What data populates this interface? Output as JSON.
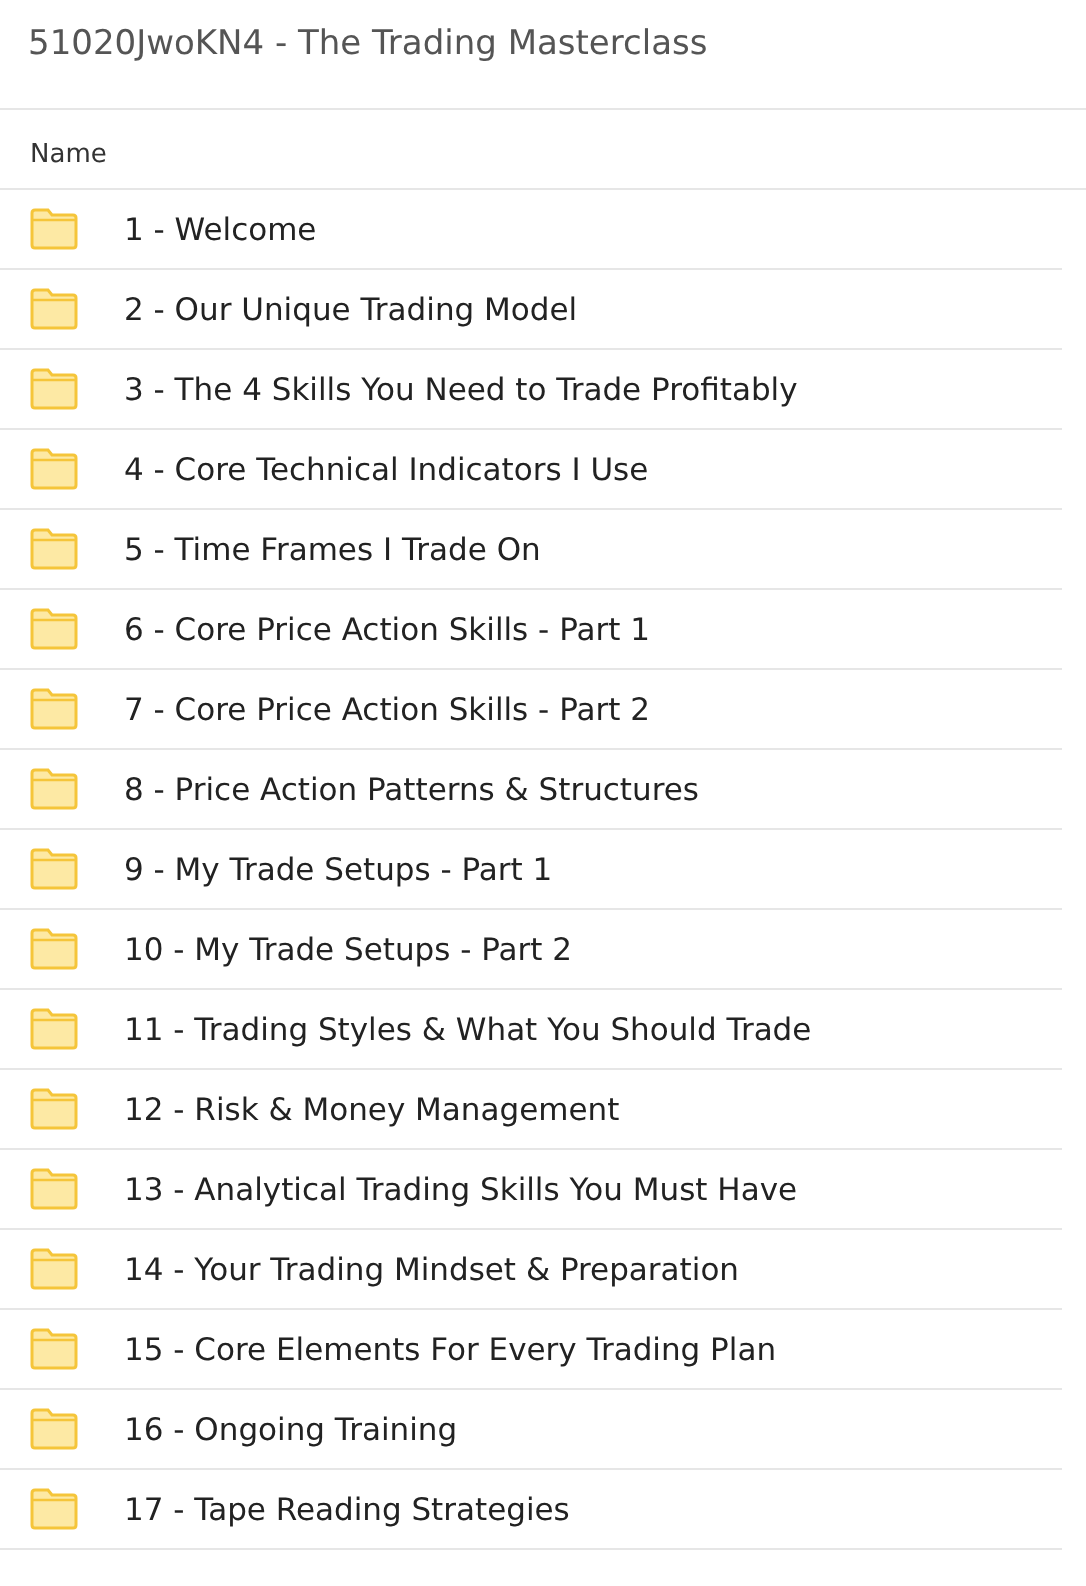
{
  "title": "51020JwoKN4 - The Trading Masterclass",
  "column_header": "Name",
  "items": [
    {
      "name": "1 - Welcome"
    },
    {
      "name": "2 - Our Unique Trading Model"
    },
    {
      "name": "3 - The 4 Skills You Need to Trade Profitably"
    },
    {
      "name": "4 - Core Technical Indicators I Use"
    },
    {
      "name": "5 - Time Frames I Trade On"
    },
    {
      "name": "6 - Core Price Action Skills - Part 1"
    },
    {
      "name": "7 - Core Price Action Skills - Part 2"
    },
    {
      "name": "8 - Price Action Patterns & Structures"
    },
    {
      "name": "9 - My Trade Setups - Part 1"
    },
    {
      "name": "10 - My Trade Setups - Part 2"
    },
    {
      "name": "11 - Trading Styles & What You Should Trade"
    },
    {
      "name": "12 - Risk & Money Management"
    },
    {
      "name": "13 - Analytical Trading Skills You Must Have"
    },
    {
      "name": "14 - Your Trading Mindset & Preparation"
    },
    {
      "name": "15 - Core Elements For Every Trading Plan"
    },
    {
      "name": "16 - Ongoing Training"
    },
    {
      "name": "17 - Tape Reading Strategies"
    }
  ]
}
